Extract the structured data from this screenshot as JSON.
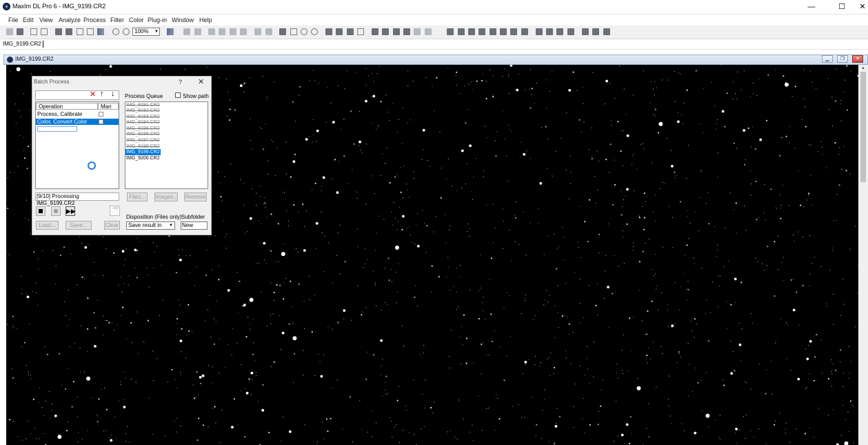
{
  "window": {
    "title": "MaxIm DL Pro 6 - IMG_9199.CR2"
  },
  "caption_buttons": {
    "minimize": "—",
    "maximize": "☐",
    "close": "✕"
  },
  "menu": [
    "File",
    "Edit",
    "View",
    "Analyze",
    "Process",
    "Filter",
    "Color",
    "Plug-in",
    "Window",
    "Help"
  ],
  "toolbar": {
    "zoom": "100%"
  },
  "image_tab": "IMG_9199.CR2",
  "image_window": {
    "title": "IMG_9199.CR2",
    "buttons": {
      "minimize": "▁",
      "restore": "❐",
      "close": "✕"
    }
  },
  "batch": {
    "title": "Batch Process",
    "help": "?",
    "close": "✕",
    "op_toolbar": {
      "delete": "✕",
      "up": "↑",
      "down": "↓"
    },
    "columns": {
      "operation": "Operation",
      "man": "Man"
    },
    "operations": [
      {
        "name": "Process, Calibrate"
      },
      {
        "name": "Color, Convert Color"
      }
    ],
    "status": "[9/10] Processing IMG_9199.CR2",
    "controls": {
      "ffwd": "▶▶"
    },
    "stepper": "<<",
    "buttons": {
      "load": "Load...",
      "save": "Save...",
      "clear": "Clear",
      "files": "Files...",
      "images": "Images...",
      "remove": "Remove"
    },
    "queue_label": "Process Queue",
    "show_path": "Show path",
    "queue": [
      "IMG_9191.CR2",
      "IMG_9192.CR2",
      "IMG_9193.CR2",
      "IMG_9194.CR2",
      "IMG_9195.CR2",
      "IMG_9196.CR2",
      "IMG_9197.CR2",
      "IMG_9198.CR2",
      "IMG_9199.CR2",
      "IMG_9200.CR2"
    ],
    "disposition_label": "Disposition (Files only)",
    "disposition": "Save result in",
    "subfolder_label": "Subfolder",
    "subfolder": "New"
  }
}
